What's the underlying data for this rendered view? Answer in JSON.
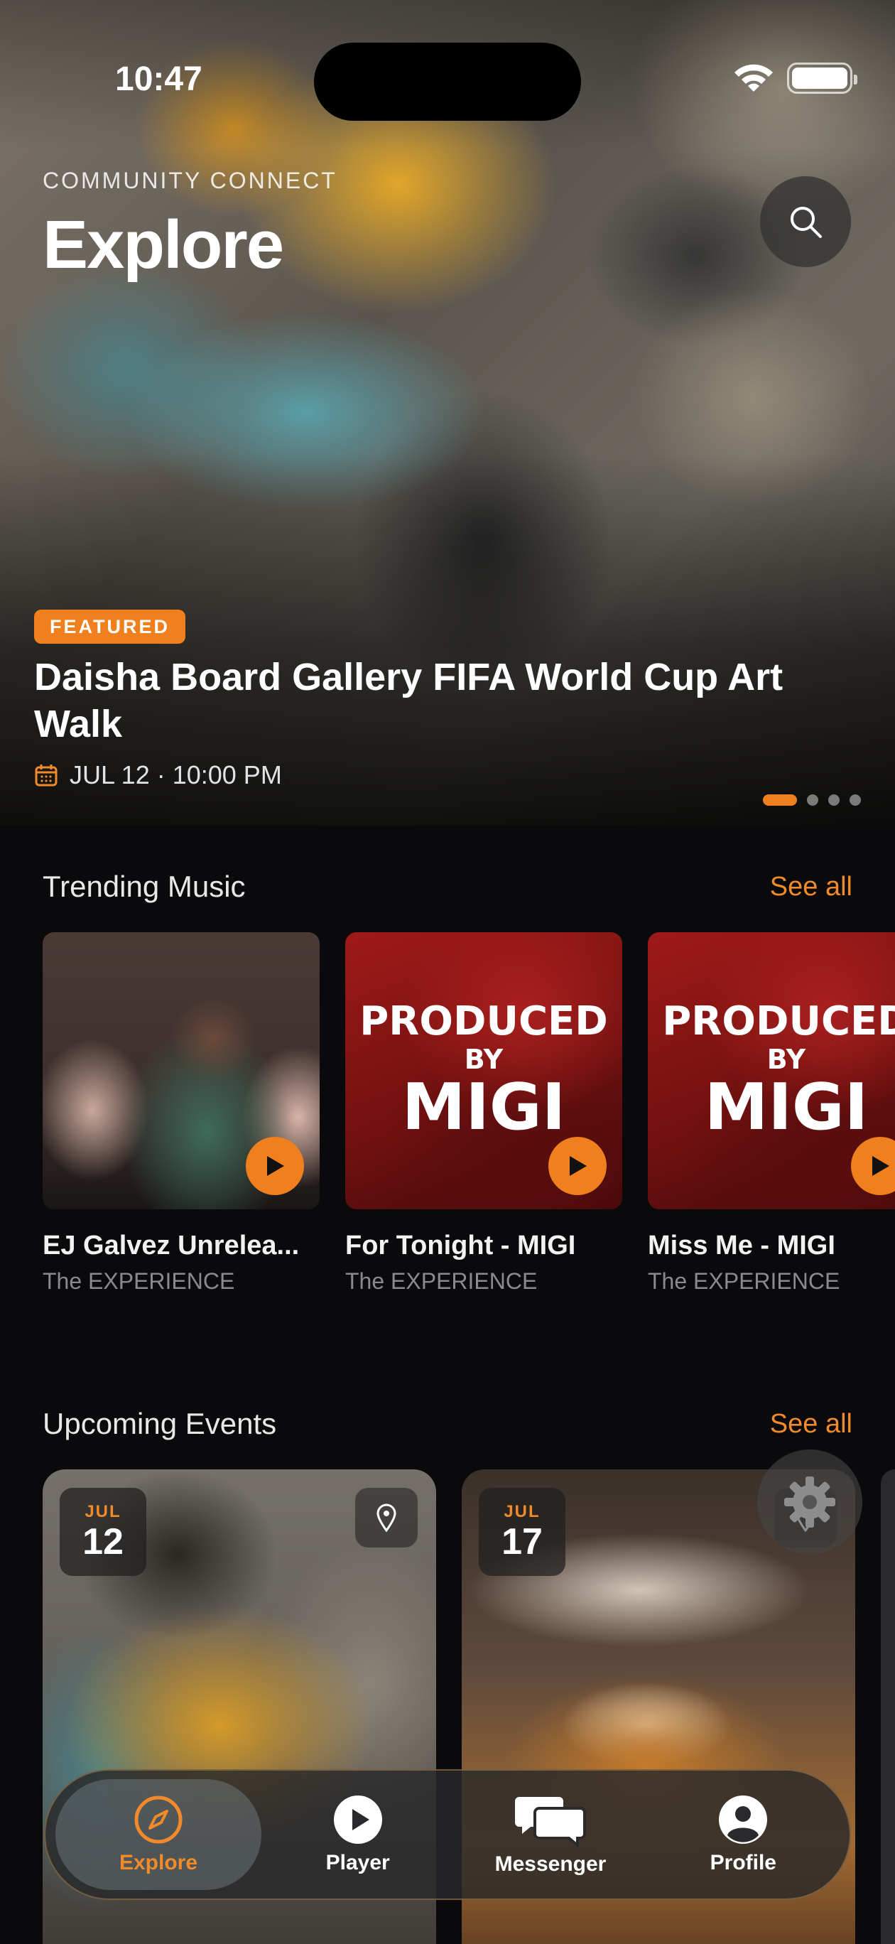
{
  "status_bar": {
    "time": "10:47"
  },
  "header": {
    "brand": "COMMUNITY CONNECT",
    "title": "Explore"
  },
  "featured": {
    "badge": "FEATURED",
    "title": "Daisha Board Gallery FIFA World Cup Art Walk",
    "date": "JUL 12 · 10:00 PM",
    "carousel_pages": 4,
    "active_page": 1
  },
  "trending": {
    "title": "Trending Music",
    "see_all": "See all",
    "items": [
      {
        "title": "EJ Galvez Unrelea...",
        "artist": "The EXPERIENCE"
      },
      {
        "title": "For Tonight - MIGI",
        "artist": "The EXPERIENCE",
        "art_lines": [
          "PRODUCED",
          "BY",
          "MIGI"
        ]
      },
      {
        "title": "Miss Me - MIGI",
        "artist": "The EXPERIENCE",
        "art_lines": [
          "PRODUCED",
          "BY",
          "MIGI"
        ]
      }
    ]
  },
  "events": {
    "title": "Upcoming Events",
    "see_all": "See all",
    "items": [
      {
        "month": "JUL",
        "day": "12"
      },
      {
        "month": "JUL",
        "day": "17"
      }
    ]
  },
  "tabbar": {
    "tabs": [
      {
        "label": "Explore",
        "icon": "compass-icon",
        "active": true
      },
      {
        "label": "Player",
        "icon": "play-circle-icon",
        "active": false
      },
      {
        "label": "Messenger",
        "icon": "chat-bubbles-icon",
        "active": false
      },
      {
        "label": "Profile",
        "icon": "person-circle-icon",
        "active": false
      }
    ]
  },
  "colors": {
    "accent": "#f07f1d",
    "background": "#0a0a0c",
    "muted_text": "#8a8a8e"
  }
}
